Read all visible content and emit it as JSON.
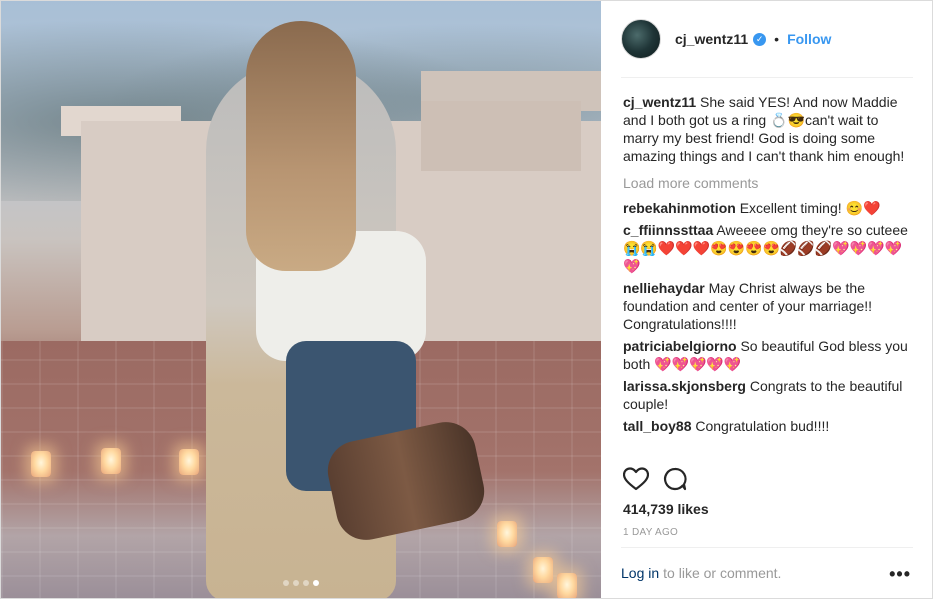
{
  "post": {
    "username": "cj_wentz11",
    "separator": "•",
    "follow_label": "Follow",
    "verified_glyph": "✓"
  },
  "caption": {
    "username": "cj_wentz11",
    "text": "She said YES! And now Maddie and I both got us a ring 💍😎can't wait to marry my best friend! God is doing some amazing things and I can't thank him enough!"
  },
  "load_more_label": "Load more comments",
  "comments": [
    {
      "username": "rebekahinmotion",
      "text": "Excellent timing! 😊❤️"
    },
    {
      "username": "c_ffiinnssttaa",
      "text": "Aweeee omg they're so cuteee😭😭❤️❤️❤️😍😍😍😍🏈🏈🏈💖💖💖💖💖"
    },
    {
      "username": "nelliehaydar",
      "text": "May Christ always be the foundation and center of your marriage!! Congratulations!!!!"
    },
    {
      "username": "patriciabelgiorno",
      "text": "So beautiful God bless you both 💖💖💖💖💖"
    },
    {
      "username": "larissa.skjonsberg",
      "text": "Congrats to the beautiful couple!"
    },
    {
      "username": "tall_boy88",
      "text": "Congratulation bud!!!!"
    }
  ],
  "likes": "414,739 likes",
  "timestamp": "1 DAY AGO",
  "footer": {
    "login_label": "Log in",
    "login_rest": "to like or comment.",
    "more_label": "•••"
  },
  "carousel": {
    "count": 4,
    "active_index": 3
  },
  "icons": {
    "like": "heart-icon",
    "comment": "comment-icon",
    "verified": "verified-badge-icon",
    "more": "more-options-icon"
  },
  "colors": {
    "link_blue": "#3897f0",
    "text": "#262626",
    "muted": "#999999",
    "login_blue": "#003569"
  }
}
